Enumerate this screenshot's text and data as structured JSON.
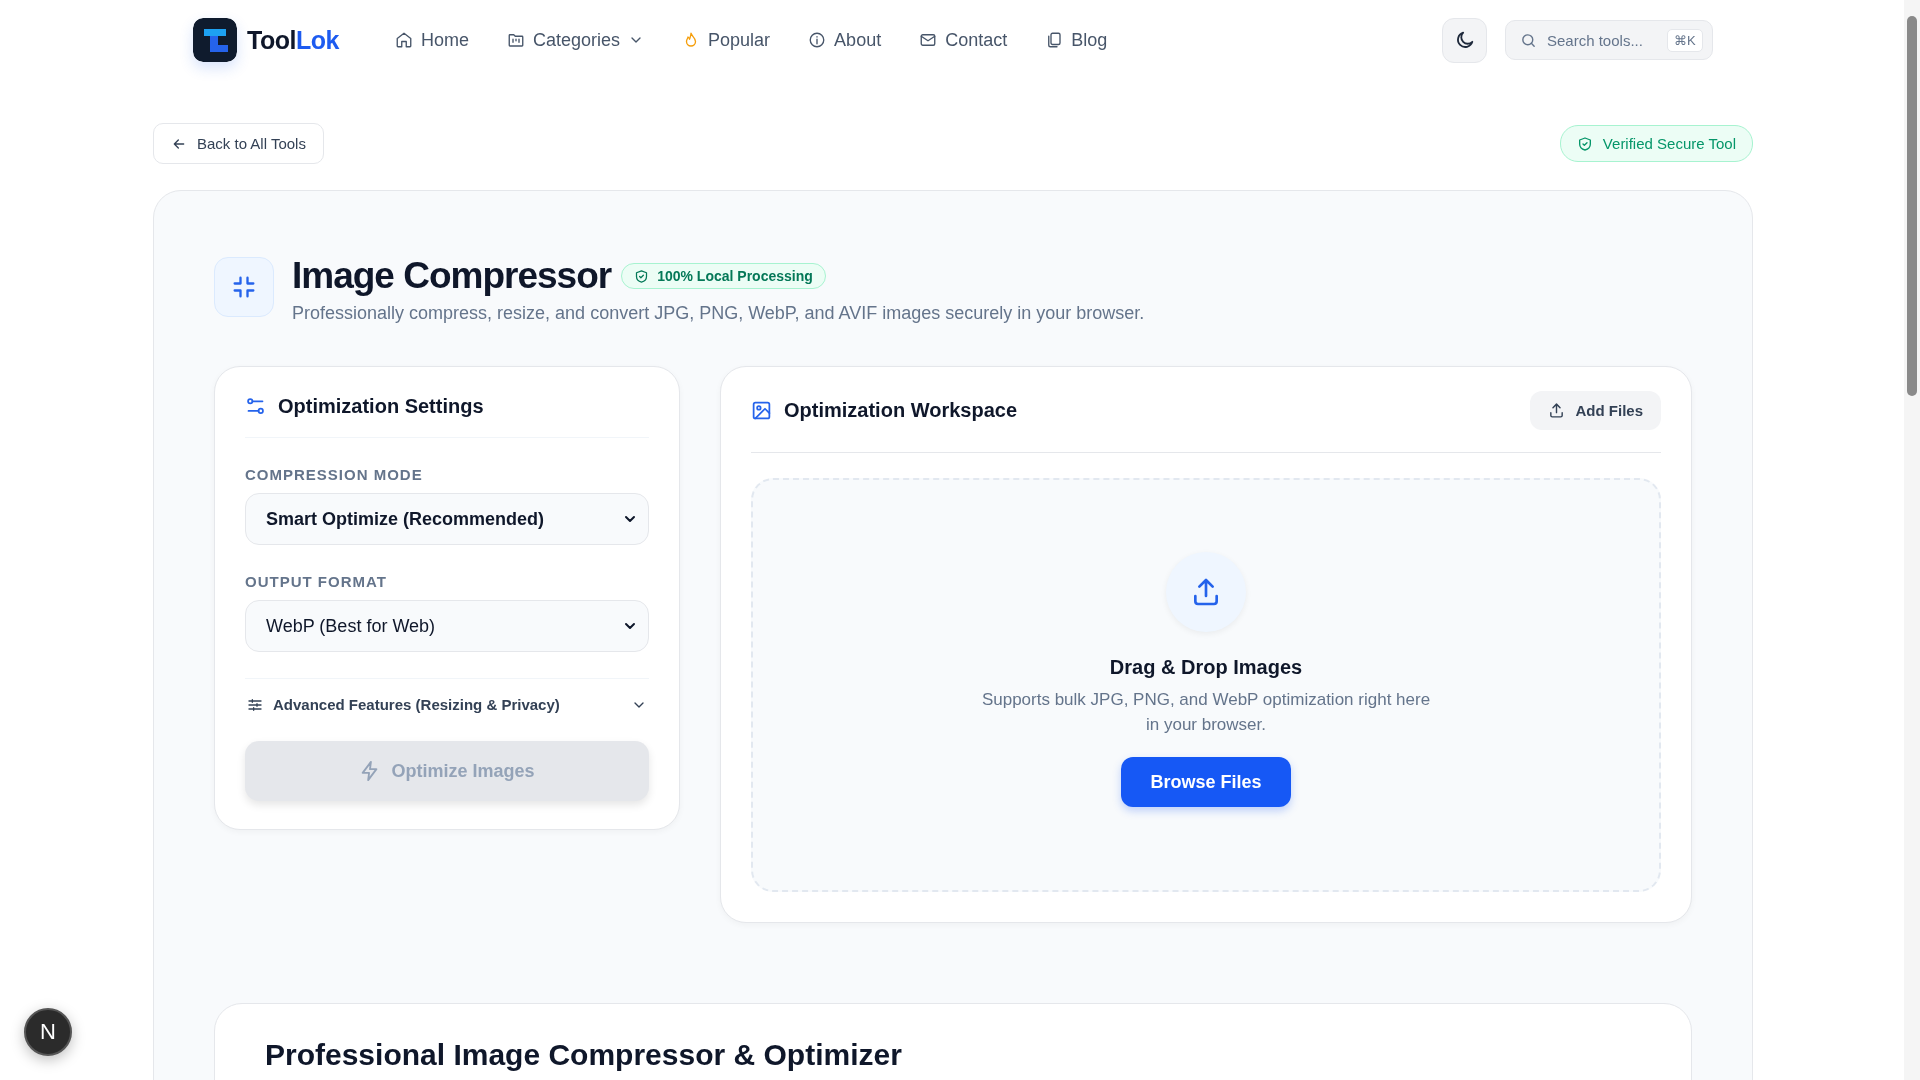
{
  "brand": {
    "name_dark": "Tool",
    "name_accent": "Lok"
  },
  "nav": [
    {
      "label": "Home",
      "has_menu": false
    },
    {
      "label": "Categories",
      "has_menu": true
    },
    {
      "label": "Popular",
      "has_menu": false
    },
    {
      "label": "About",
      "has_menu": false
    },
    {
      "label": "Contact",
      "has_menu": false
    },
    {
      "label": "Blog",
      "has_menu": false
    }
  ],
  "search": {
    "placeholder": "Search tools...",
    "shortcut": "⌘K"
  },
  "back_link": "Back to All Tools",
  "verified_badge": "Verified Secure Tool",
  "tool": {
    "title": "Image Compressor",
    "badge": "100% Local Processing",
    "description": "Professionally compress, resize, and convert JPG, PNG, WebP, and AVIF images securely in your browser."
  },
  "settings": {
    "title": "Optimization Settings",
    "fields": [
      {
        "label": "COMPRESSION MODE",
        "value": "Smart Optimize (Recommended)",
        "emphasized": true
      },
      {
        "label": "OUTPUT FORMAT",
        "value": "WebP (Best for Web)",
        "emphasized": false
      }
    ],
    "advanced": {
      "label": "Advanced Features (Resizing & Privacy)",
      "expanded": false
    },
    "action": {
      "label": "Optimize Images",
      "disabled": true
    }
  },
  "workspace": {
    "title": "Optimization Workspace",
    "add_button": "Add Files",
    "dropzone": {
      "title": "Drag & Drop Images",
      "text": "Supports bulk JPG, PNG, and WebP optimization right here in your browser.",
      "button": "Browse Files"
    }
  },
  "article": {
    "heading": "Professional Image Compressor & Optimizer"
  },
  "dev_badge": "N"
}
